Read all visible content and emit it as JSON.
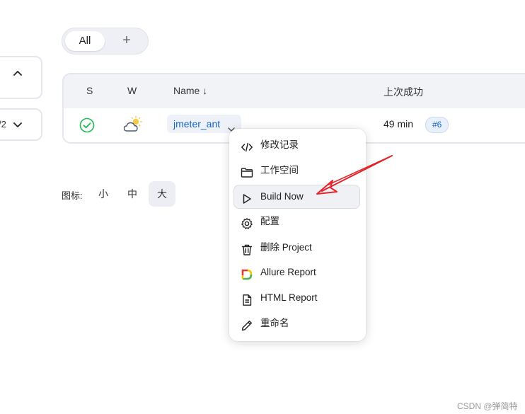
{
  "tabs": {
    "all_label": "All",
    "add_label": "+"
  },
  "left_cards": {
    "partial_text": "/2"
  },
  "table": {
    "headers": {
      "status": "S",
      "weather": "W",
      "name": "Name ↓",
      "last_success": "上次成功"
    },
    "row": {
      "job_name": "jmeter_ant",
      "last_success": "49 min",
      "build_badge": "#6"
    }
  },
  "icon_size": {
    "label": "图标:",
    "small": "小",
    "medium": "中",
    "large": "大",
    "selected": "大"
  },
  "menu": {
    "items": [
      {
        "label": "修改记录",
        "icon": "code-icon"
      },
      {
        "label": "工作空间",
        "icon": "folder-icon"
      },
      {
        "label": "Build Now",
        "icon": "play-icon"
      },
      {
        "label": "配置",
        "icon": "gear-icon"
      },
      {
        "label": "删除 Project",
        "icon": "trash-icon"
      },
      {
        "label": "Allure Report",
        "icon": "allure-icon"
      },
      {
        "label": "HTML Report",
        "icon": "document-icon"
      },
      {
        "label": "重命名",
        "icon": "pencil-icon"
      }
    ],
    "highlighted": "Build Now"
  },
  "colors": {
    "accent": "#1666c7",
    "success": "#1db954",
    "annotation_arrow": "#e0252b",
    "allure_yellow": "#f5c400",
    "allure_red": "#e53935",
    "allure_green": "#4caf50"
  },
  "watermark": "CSDN @弹简特"
}
